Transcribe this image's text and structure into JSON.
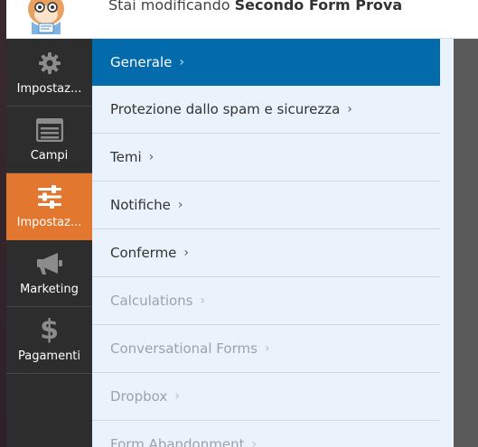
{
  "header": {
    "prefix": "Stai modificando",
    "form_name": "Secondo Form Prova"
  },
  "sidebar": {
    "items": [
      {
        "label": "Impostaz...",
        "icon": "gear-icon",
        "active": false
      },
      {
        "label": "Campi",
        "icon": "fields-list-icon",
        "active": false
      },
      {
        "label": "Impostaz...",
        "icon": "sliders-icon",
        "active": true
      },
      {
        "label": "Marketing",
        "icon": "megaphone-icon",
        "active": false
      },
      {
        "label": "Pagamenti",
        "icon": "dollar-icon",
        "active": false
      }
    ]
  },
  "menu": {
    "items": [
      {
        "label": "Generale",
        "state": "active"
      },
      {
        "label": "Protezione dallo spam e sicurezza",
        "state": "normal"
      },
      {
        "label": "Temi",
        "state": "normal"
      },
      {
        "label": "Notifiche",
        "state": "normal"
      },
      {
        "label": "Conferme",
        "state": "normal"
      },
      {
        "label": "Calculations",
        "state": "disabled"
      },
      {
        "label": "Conversational Forms",
        "state": "disabled"
      },
      {
        "label": "Dropbox",
        "state": "disabled"
      },
      {
        "label": "Form Abandonment",
        "state": "disabled"
      }
    ],
    "chevron": "›"
  },
  "colors": {
    "accent_active": "#036aab",
    "sidebar_active": "#e27730",
    "sidebar_bg": "#2d2d2d",
    "menu_bg": "#eaf2fb"
  }
}
